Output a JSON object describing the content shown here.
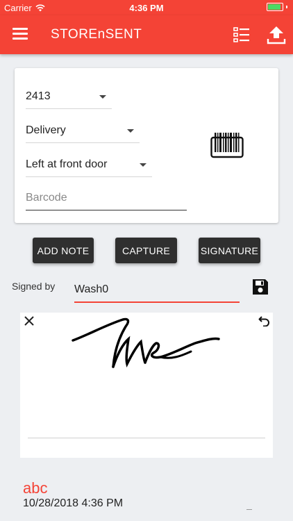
{
  "status_bar": {
    "carrier": "Carrier",
    "time": "4:36 PM",
    "battery_level": 1.0
  },
  "app_bar": {
    "title": "STOREnSENT",
    "icons": [
      "menu-icon",
      "list-icon",
      "upload-icon"
    ]
  },
  "form": {
    "selects": {
      "store": "2413",
      "type": "Delivery",
      "status": "Left at front door"
    },
    "barcode": {
      "value": "",
      "placeholder": "Barcode"
    },
    "scan_icon": "barcode-icon"
  },
  "actions": {
    "add_note": "ADD NOTE",
    "capture": "CAPTURE",
    "signature": "SIGNATURE"
  },
  "signed_by": {
    "label": "Signed by",
    "value": "Wash0",
    "save_icon": "floppy-disk-icon"
  },
  "signature_pad": {
    "clear_icon": "close-icon",
    "undo_icon": "undo-icon"
  },
  "notes": [
    {
      "title": "abc",
      "timestamp": "10/28/2018 4:36 PM"
    }
  ],
  "colors": {
    "primary": "#f44336",
    "button_dark": "#2f2f2f",
    "background": "#edeff2",
    "battery": "#4cd964"
  }
}
